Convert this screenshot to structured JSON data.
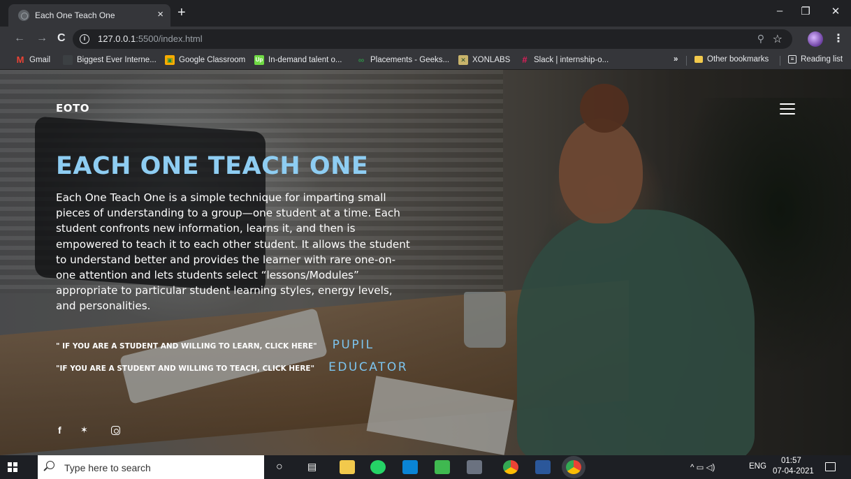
{
  "browser": {
    "tab_title": "Each One Teach One",
    "tab_close": "×",
    "new_tab": "+",
    "window_controls": {
      "minimize": "–",
      "maximize": "❐",
      "close": "✕"
    },
    "nav": {
      "back": "←",
      "forward": "→",
      "reload": "C"
    },
    "url_host": "127.0.0.1",
    "url_rest": ":5500/index.html",
    "bookmarks": [
      {
        "label": "Gmail",
        "icon": "gmail-icon",
        "color": "#ea4335",
        "glyph": "M"
      },
      {
        "label": "Biggest Ever Interne...",
        "icon": "page-icon",
        "color": "#3c4043",
        "glyph": ""
      },
      {
        "label": "Google Classroom",
        "icon": "classroom-icon",
        "color": "#f9ab00",
        "glyph": "▣"
      },
      {
        "label": "In-demand talent o...",
        "icon": "upwork-icon",
        "color": "#6fda44",
        "glyph": "Up"
      },
      {
        "label": "Placements - Geeks...",
        "icon": "geeksforgeeks-icon",
        "color": "#2f8d46",
        "glyph": "∞"
      },
      {
        "label": "XONLABS",
        "icon": "xonlabs-icon",
        "color": "#c9b46b",
        "glyph": "✕"
      },
      {
        "label": "Slack | internship-o...",
        "icon": "slack-icon",
        "color": "#e01e5a",
        "glyph": "#"
      }
    ],
    "bookmarks_overflow": "»",
    "other_bookmarks": "Other bookmarks",
    "reading_list": "Reading list"
  },
  "site": {
    "logo": "EOTO",
    "hero_title": "EACH ONE TEACH ONE",
    "hero_text": "Each One Teach One is a simple technique for imparting small pieces of understanding to a group—one student at a time. Each student confronts new information, learns it, and then is empowered to teach it to each other student. It allows the student to understand better and provides the learner with rare one-on-one attention and lets students select “lessons/Modules” appropriate to particular student learning styles, energy levels, and personalities.",
    "cta": [
      {
        "text": "\" IF YOU ARE A STUDENT AND WILLING TO LEARN, CLICK HERE\"",
        "link": "PUPIL"
      },
      {
        "text": "\"IF YOU ARE A STUDENT AND WILLING TO TEACH, CLICK HERE\"",
        "link": "EDUCATOR"
      }
    ],
    "social": {
      "facebook": "f",
      "twitter": "🐦",
      "instagram": ""
    },
    "accent_color": "#8ecdf2"
  },
  "taskbar": {
    "search_placeholder": "Type here to search",
    "tray_lang": "ENG",
    "tray_icons": "^ ▭ ◁)",
    "time": "01:57",
    "date": "07-04-2021"
  }
}
